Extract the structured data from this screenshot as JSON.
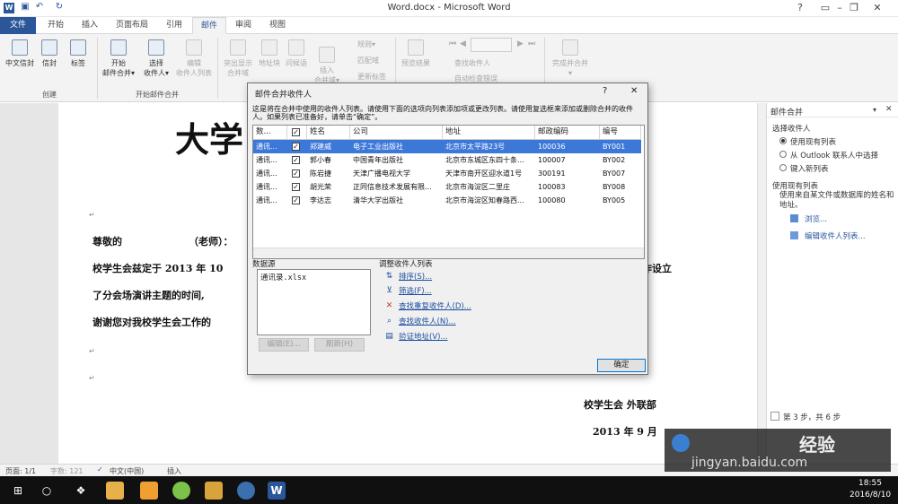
{
  "title_bar": {
    "window_title": "Word.docx - Microsoft Word"
  },
  "tabs": [
    "文件",
    "开始",
    "插入",
    "页面布局",
    "引用",
    "邮件",
    "审阅",
    "视图"
  ],
  "ribbon": {
    "create_group": {
      "label": "创建",
      "buttons": [
        "中文信封",
        "信封",
        "标签"
      ]
    },
    "start_group": {
      "label": "开始邮件合并",
      "buttons": [
        [
          "开始",
          "邮件合并▾"
        ],
        [
          "选择",
          "收件人▾"
        ],
        [
          "编辑",
          "收件人列表"
        ]
      ]
    },
    "write_group": {
      "buttons": [
        [
          "突出显示",
          "合并域"
        ],
        [
          "地址块"
        ],
        [
          "问候语"
        ],
        [
          "插入",
          "合并域▾"
        ]
      ],
      "small": [
        "规则▾",
        "匹配域",
        "更新标签"
      ]
    },
    "preview_group": {
      "buttons": [
        "预览结果"
      ],
      "small": [
        "查找收件人",
        "自动检查错误"
      ]
    },
    "finish_group": {
      "buttons": [
        [
          "完成并合并",
          "▾"
        ]
      ]
    }
  },
  "document": {
    "heading": "大学",
    "salutation": "尊敬的",
    "salutation_suffix": "（老师）：",
    "line1": "校学生会兹定于 2013 年 10",
    "line1_end": "作设立",
    "line2": "了分会场演讲主题的时间,",
    "line3": "谢谢您对我校学生会工作的",
    "sign": "校学生会  外联部",
    "date": "2013 年 9 月"
  },
  "dialog": {
    "title": "邮件合并收件人",
    "help": "?",
    "close": "✕",
    "description": "这是将在合并中使用的收件人列表。请使用下面的选项向列表添加项或更改列表。请使用复选框来添加或删除合并的收件人。如果列表已准备好，请单击“确定”。",
    "columns": [
      "数...",
      "",
      "姓名",
      "公司",
      "地址",
      "邮政编码",
      "编号"
    ],
    "rows": [
      {
        "source": "通讯...",
        "name": "郑建威",
        "company": "电子工业出版社",
        "address": "北京市太平路23号",
        "zip": "100036",
        "code": "BY001"
      },
      {
        "source": "通讯...",
        "name": "郭小春",
        "company": "中国青年出版社",
        "address": "北京市东城区东四十条...",
        "zip": "100007",
        "code": "BY002"
      },
      {
        "source": "通讯...",
        "name": "陈岩捷",
        "company": "天津广播电视大学",
        "address": "天津市南开区迎水道1号",
        "zip": "300191",
        "code": "BY007"
      },
      {
        "source": "通讯...",
        "name": "胡光荣",
        "company": "正同信息技术发展有限...",
        "address": "北京市海淀区二里庄",
        "zip": "100083",
        "code": "BY008"
      },
      {
        "source": "通讯...",
        "name": "李达志",
        "company": "清华大学出版社",
        "address": "北京市海淀区知春路西...",
        "zip": "100080",
        "code": "BY005"
      }
    ],
    "datasource_label": "数据源",
    "datasource_item": "通讯录.xlsx",
    "edit_button": "编辑(E)...",
    "refresh_button": "刷新(H)",
    "refine_label": "调整收件人列表",
    "links": [
      "排序(S)...",
      "筛选(F)...",
      "查找重复收件人(D)...",
      "查找收件人(N)...",
      "验证地址(V)..."
    ],
    "ok_button": "确定"
  },
  "pane": {
    "title": "邮件合并",
    "select_label": "选择收件人",
    "options": [
      "使用现有列表",
      "从 Outlook 联系人中选择",
      "键入新列表"
    ],
    "use_existing_title": "使用现有列表",
    "use_existing_desc": "使用来自某文件或数据库的姓名和地址。",
    "browse": "浏览...",
    "edit_list": "编辑收件人列表...",
    "step": "第 3 步，共 6 步"
  },
  "status_bar": {
    "page": "页面: 1/1",
    "words": "字数: 121",
    "lang": "中文(中国)",
    "mode": "插入"
  },
  "taskbar": {
    "time": "18:55",
    "date": "2016/8/10"
  },
  "watermark": {
    "brand": "经验",
    "url": "jingyan.baidu.com"
  },
  "colors": {
    "word_blue": "#2b579a",
    "selection": "#3c78d8"
  }
}
